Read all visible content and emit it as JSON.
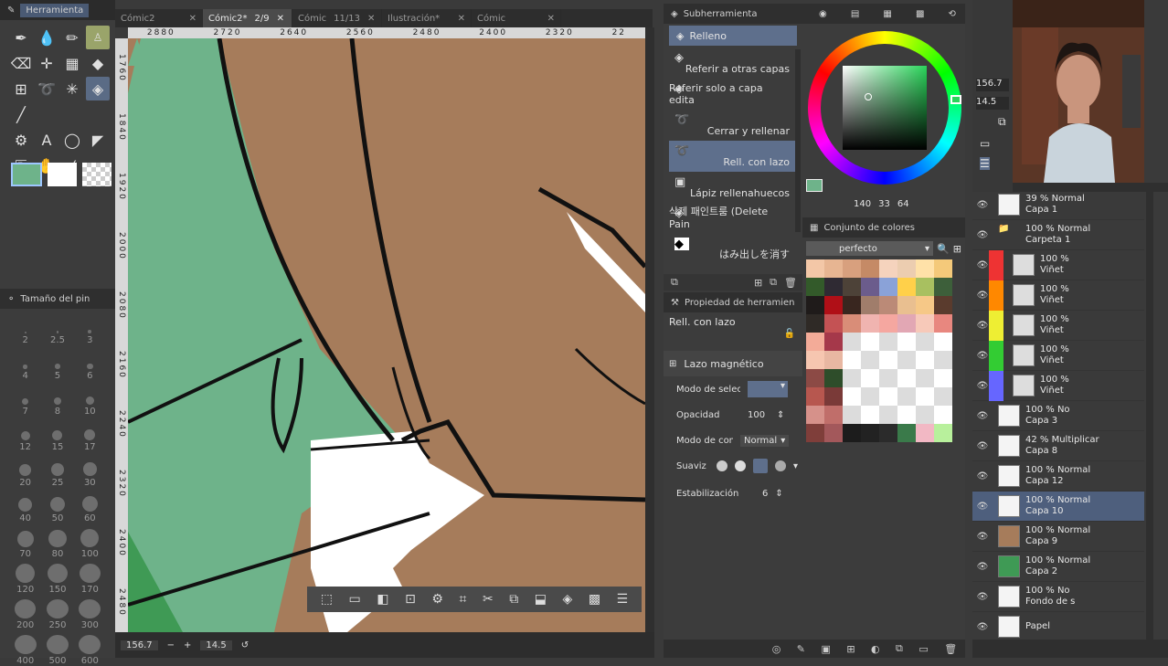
{
  "left_panel": {
    "header": "Herramienta",
    "brush_panel_header": "Tamaño del pin",
    "brush_sizes": [
      "2",
      "2.5",
      "3",
      "4",
      "5",
      "6",
      "7",
      "8",
      "10",
      "12",
      "15",
      "17",
      "20",
      "25",
      "30",
      "40",
      "50",
      "60",
      "70",
      "80",
      "100",
      "120",
      "150",
      "170",
      "200",
      "250",
      "300",
      "400",
      "500",
      "600"
    ],
    "colors": {
      "main": "#6eb38a",
      "sub": "#ffffff"
    }
  },
  "tabs": [
    {
      "label": "Cómic2",
      "extra": ""
    },
    {
      "label": "Cómic2*",
      "extra": "2/9"
    },
    {
      "label": "Cómic",
      "extra": "11/13"
    },
    {
      "label": "Ilustración*",
      "extra": ""
    },
    {
      "label": "Cómic",
      "extra": ""
    }
  ],
  "ruler_top": [
    "2880",
    "2720",
    "2640",
    "2560",
    "2480",
    "2400",
    "2320",
    "22"
  ],
  "ruler_left": [
    "1760",
    "1840",
    "1920",
    "2000",
    "2080",
    "2160",
    "2240",
    "2320",
    "2400",
    "2480"
  ],
  "status": {
    "zoom": "156.7",
    "angle": "14.5"
  },
  "subtool": {
    "header": "Subherramienta",
    "group": "Relleno",
    "items": [
      {
        "label": "Referir a otras capas"
      },
      {
        "label": "Referir solo a capa edita"
      },
      {
        "label": "Cerrar y rellenar"
      },
      {
        "label": "Rell. con lazo"
      },
      {
        "label": "Lápiz rellenahuecos"
      },
      {
        "label": "삭제 패인트룸 (Delete Pain"
      },
      {
        "label": "はみ出しを消す"
      }
    ]
  },
  "tool_property": {
    "header": "Propiedad de herramien",
    "tool_name": "Rell. con lazo",
    "magnetic_lasso": "Lazo magnético",
    "selection_mode_label": "Modo de seleccı",
    "opacity_label": "Opacidad",
    "opacity_value": "100",
    "blend_mode_label": "Modo de comb",
    "blend_mode_value": "Normal",
    "smooth_label": "Suaviz",
    "stabilization_label": "Estabilización",
    "stabilization_value": "6"
  },
  "color_wheel": {
    "values": [
      "140",
      "33",
      "64"
    ],
    "current_color": "#6eb38a"
  },
  "color_set": {
    "header": "Conjunto de colores",
    "set_name": "perfecto"
  },
  "layer_panel": {
    "hsv_values": [
      "156.7",
      "14.5"
    ],
    "layers": [
      {
        "line1": "39 % Normal",
        "line2": "Capa 1"
      },
      {
        "line1": "100 % Normal",
        "line2": "Carpeta 1"
      },
      {
        "line1": "100 %",
        "line2": "Viñet"
      },
      {
        "line1": "100 %",
        "line2": "Viñet"
      },
      {
        "line1": "100 %",
        "line2": "Viñet"
      },
      {
        "line1": "100 %",
        "line2": "Viñet"
      },
      {
        "line1": "100 %",
        "line2": "Viñet"
      },
      {
        "line1": "100 % No",
        "line2": "Capa 3"
      },
      {
        "line1": "42 % Multiplicar",
        "line2": "Capa 8"
      },
      {
        "line1": "100 % Normal",
        "line2": "Capa 12"
      },
      {
        "line1": "100 % Normal",
        "line2": "Capa 10"
      },
      {
        "line1": "100 % Normal",
        "line2": "Capa 9"
      },
      {
        "line1": "100 % Normal",
        "line2": "Capa 2"
      },
      {
        "line1": "100 % No",
        "line2": "Fondo de s"
      },
      {
        "line1": "Papel",
        "line2": ""
      }
    ]
  }
}
